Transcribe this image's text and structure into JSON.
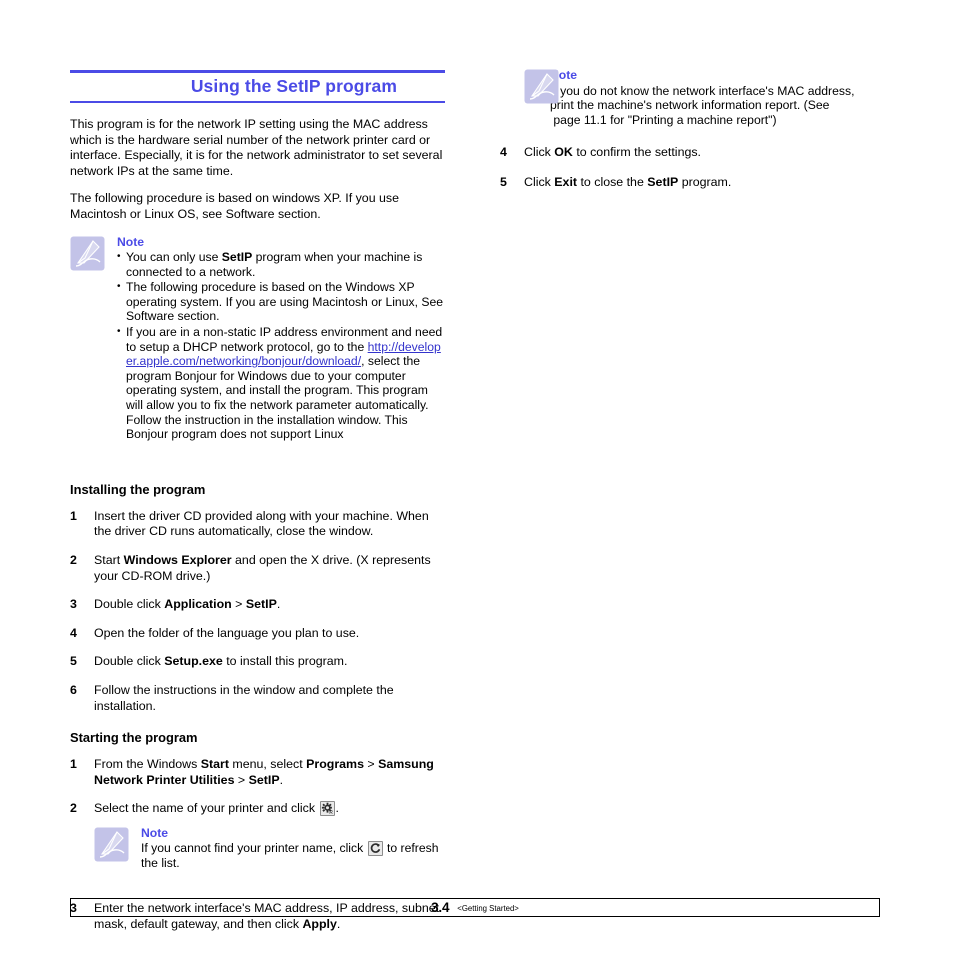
{
  "document": {
    "heading": "Using the SetIP program",
    "intro_paragraphs": [
      "This program is for the network IP setting using the MAC address which is the hardware serial number of the network printer card or interface. Especially, it is for the network administrator to set several network IPs at the same time.",
      "The following procedure is based on windows XP. If you use Macintosh or Linux OS, see Software section."
    ]
  },
  "note_main": {
    "label": "Note",
    "bullets": [
      {
        "before": "You can only use ",
        "bold": "SetIP",
        "after": " program when your machine is connected to a network."
      },
      {
        "before": "The following procedure is based on the Windows XP operating system. If you are using Macintosh or Linux, See Software section.",
        "bold": "",
        "after": ""
      },
      {
        "before": "If you are in a non-static IP address environment and need to setup a DHCP network protocol, go to the ",
        "link": "http://developer.apple.com/networking/bonjour/download/",
        "after": ", select the program Bonjour for Windows due to your computer operating system, and install the program. This program will allow you to fix the network parameter automatically. Follow the instruction in the installation window. This Bonjour program does not support Linux"
      }
    ]
  },
  "installing": {
    "heading": "Installing the program",
    "steps": [
      {
        "num": "1",
        "parts": [
          {
            "t": "Insert the driver CD provided along with your machine. When the driver CD runs automatically, close the window.",
            "b": false
          }
        ]
      },
      {
        "num": "2",
        "parts": [
          {
            "t": "Start ",
            "b": false
          },
          {
            "t": "Windows Explorer",
            "b": true
          },
          {
            "t": " and open the X drive. (X represents your CD-ROM drive.)",
            "b": false
          }
        ]
      },
      {
        "num": "3",
        "parts": [
          {
            "t": "Double click ",
            "b": false
          },
          {
            "t": "Application",
            "b": true
          },
          {
            "t": " > ",
            "b": false
          },
          {
            "t": "SetIP",
            "b": true
          },
          {
            "t": ".",
            "b": false
          }
        ]
      },
      {
        "num": "4",
        "parts": [
          {
            "t": "Open the folder of the language you plan to use.",
            "b": false
          }
        ]
      },
      {
        "num": "5",
        "parts": [
          {
            "t": "Double click ",
            "b": false
          },
          {
            "t": "Setup.exe",
            "b": true
          },
          {
            "t": " to install this program.",
            "b": false
          }
        ]
      },
      {
        "num": "6",
        "parts": [
          {
            "t": "Follow the instructions in the window and complete the installation.",
            "b": false
          }
        ]
      }
    ]
  },
  "starting": {
    "heading": "Starting the program",
    "step1": {
      "num": "1",
      "parts": [
        {
          "t": "From the Windows ",
          "b": false
        },
        {
          "t": "Start",
          "b": true
        },
        {
          "t": " menu, select ",
          "b": false
        },
        {
          "t": "Programs",
          "b": true
        },
        {
          "t": " > ",
          "b": false
        },
        {
          "t": "Samsung Network Printer Utilities",
          "b": true
        },
        {
          "t": " > ",
          "b": false
        },
        {
          "t": "SetIP",
          "b": true
        },
        {
          "t": ".",
          "b": false
        }
      ]
    },
    "step2": {
      "num": "2",
      "text_before": "Select the name of your printer and click",
      "icon": "gear-icon",
      "text_after": "."
    },
    "step2_note": {
      "label": "Note",
      "text_before": "If you cannot find your printer name, click",
      "icon": "refresh-icon",
      "text_after": "to refresh the list."
    },
    "step3": {
      "num": "3",
      "parts": [
        {
          "t": "Enter the network interface's MAC address, IP address, subnet mask, default gateway, and then click ",
          "b": false
        },
        {
          "t": "Apply",
          "b": true
        },
        {
          "t": ".",
          "b": false
        }
      ]
    }
  },
  "right_note": {
    "label": "Note",
    "line1": "If you do not know the network interface's MAC address,",
    "line2": "print the machine's network information report. (See",
    "line3": " page 11.1 for \"Printing a machine report\")"
  },
  "right_steps": [
    {
      "num": "4",
      "parts": [
        {
          "t": "Click ",
          "b": false
        },
        {
          "t": "OK",
          "b": true
        },
        {
          "t": " to confirm the settings.",
          "b": false
        }
      ]
    },
    {
      "num": "5",
      "parts": [
        {
          "t": "Click ",
          "b": false
        },
        {
          "t": "Exit",
          "b": true
        },
        {
          "t": " to close the ",
          "b": false
        },
        {
          "t": "SetIP",
          "b": true
        },
        {
          "t": " program.",
          "b": false
        }
      ]
    }
  ],
  "footer": {
    "page_number": "3.4",
    "section_label": "<Getting Started>"
  },
  "colors": {
    "accent": "#4b4be6",
    "link": "#3333cc",
    "note_icon_bg": "#c3c3e8",
    "text": "#000000"
  }
}
